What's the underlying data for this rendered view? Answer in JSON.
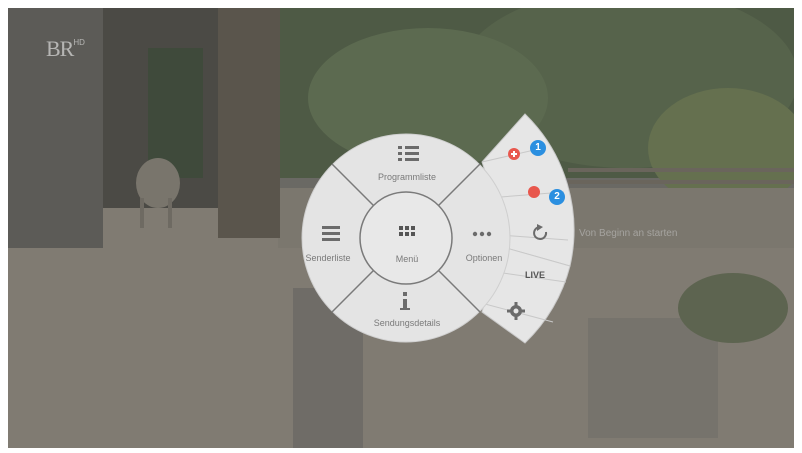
{
  "channel_logo": "BR",
  "channel_logo_sup": "HD",
  "menu": {
    "center_label": "Menü",
    "top_label": "Programmliste",
    "left_label": "Senderliste",
    "right_label": "Optionen",
    "bottom_label": "Sendungsdetails"
  },
  "side_menu": {
    "live_label": "LIVE",
    "badge1": "1",
    "badge2": "2",
    "hint_text": "Von Beginn an starten"
  },
  "colors": {
    "panel": "#e4e4e4",
    "red": "#e8574d",
    "badge": "#2b8fe0"
  },
  "icons": [
    "list-icon",
    "hamburger-icon",
    "grid-icon",
    "more-dots-icon",
    "info-icon",
    "add-icon",
    "record-icon",
    "restart-icon",
    "settings-icon"
  ]
}
